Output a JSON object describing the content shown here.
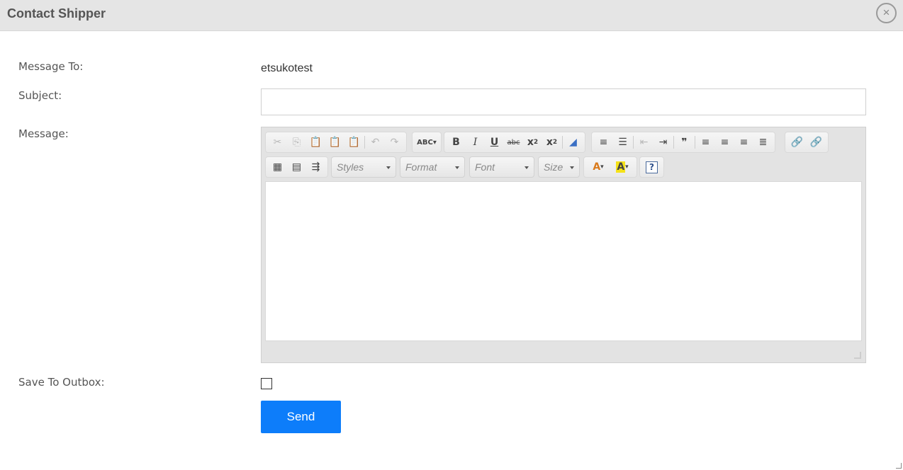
{
  "dialog": {
    "title": "Contact Shipper",
    "close_glyph": "×"
  },
  "form": {
    "message_to_label": "Message To:",
    "message_to_value": "etsukotest",
    "subject_label": "Subject:",
    "subject_value": "",
    "message_label": "Message:",
    "save_outbox_label": "Save To Outbox:",
    "save_outbox_checked": false,
    "send_label": "Send"
  },
  "editor": {
    "toolbar_row1": [
      "cut-icon",
      "copy-icon",
      "paste-icon",
      "paste-text-icon",
      "paste-word-icon",
      "undo-icon",
      "redo-icon",
      "spellcheck-icon",
      "bold-icon",
      "italic-icon",
      "underline-icon",
      "strikethrough-icon",
      "subscript-icon",
      "superscript-icon",
      "remove-format-icon",
      "numbered-list-icon",
      "bulleted-list-icon",
      "outdent-icon",
      "indent-icon",
      "blockquote-icon",
      "align-left-icon",
      "align-center-icon",
      "align-right-icon",
      "justify-icon",
      "link-icon",
      "unlink-icon"
    ],
    "toolbar_row2": [
      "table-icon",
      "horizontal-rule-icon",
      "page-break-icon",
      "text-color-icon",
      "background-color-icon",
      "help-icon"
    ],
    "styles_label": "Styles",
    "format_label": "Format",
    "font_label": "Font",
    "size_label": "Size",
    "spellcheck_glyph": "ABC",
    "content": ""
  },
  "colors": {
    "header_bg": "#e5e5e5",
    "primary_button": "#0d7dfa",
    "editor_bg": "#e3e3e3"
  }
}
